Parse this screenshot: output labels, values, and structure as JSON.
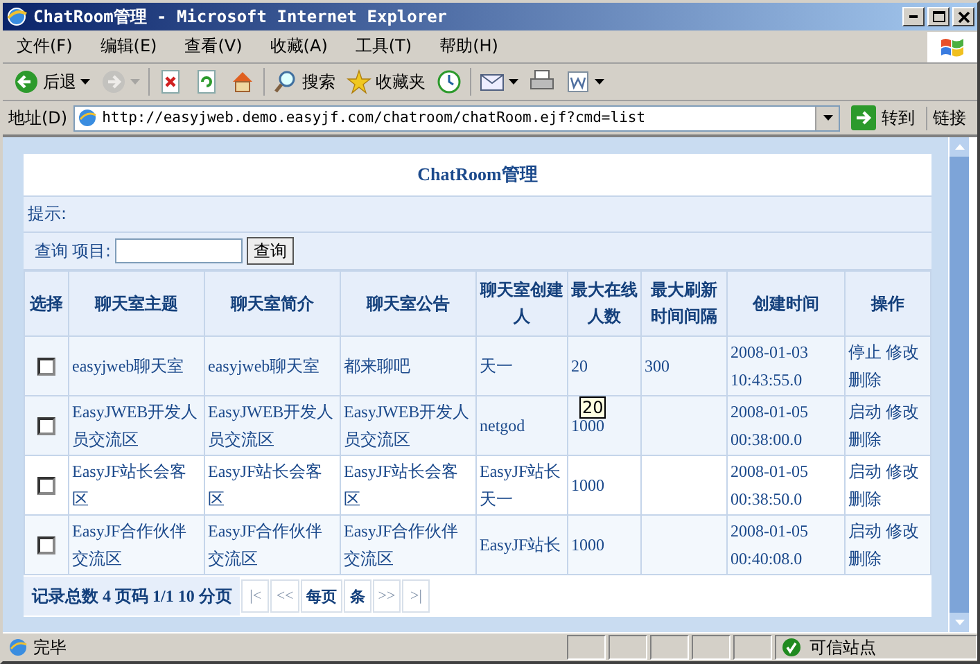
{
  "window": {
    "title": "ChatRoom管理 - Microsoft Internet Explorer"
  },
  "menu": [
    "文件(F)",
    "编辑(E)",
    "查看(V)",
    "收藏(A)",
    "工具(T)",
    "帮助(H)"
  ],
  "toolbar": [
    {
      "label": "后退",
      "caret": true,
      "disabled": false
    },
    {
      "caret": true,
      "disabled": true
    },
    {
      "caret": false,
      "disabled": false
    },
    {
      "caret": false,
      "disabled": false
    },
    {
      "caret": false,
      "disabled": false
    },
    {
      "label": "搜索",
      "caret": false,
      "disabled": false
    },
    {
      "label": "收藏夹",
      "caret": false,
      "disabled": false
    },
    {
      "caret": false,
      "disabled": false
    },
    {
      "caret": true,
      "disabled": false
    },
    {
      "caret": false,
      "disabled": false
    },
    {
      "caret": true,
      "disabled": false
    }
  ],
  "address": {
    "label": "地址(D)",
    "url": "http://easyjweb.demo.easyjf.com/chatroom/chatRoom.ejf?cmd=list",
    "go": "转到",
    "links": "链接"
  },
  "page": {
    "title": "ChatRoom管理",
    "hint": "提示:",
    "query_label": "查询",
    "field_label": "项目:",
    "query_button": "查询",
    "table": {
      "columns": [
        "选择",
        "聊天室主题",
        "聊天室简介",
        "聊天室公告",
        "聊天室创建人",
        "最大在线人数",
        "最大刷新时间间隔",
        "创建时间",
        "操作"
      ],
      "rows": [
        {
          "checked": false,
          "topic": "easyjweb聊天室",
          "intro": "easyjweb聊天室",
          "notice": "都来聊吧",
          "creator": "天一",
          "max_online": "20",
          "refresh": "300",
          "created": "2008-01-03 10:43:55.0",
          "actions": [
            "停止",
            "修改",
            "删除"
          ]
        },
        {
          "checked": false,
          "topic": "EasyJWEB开发人员交流区",
          "intro": "EasyJWEB开发人员交流区",
          "notice": "EasyJWEB开发人员交流区",
          "creator": "netgod",
          "max_online": "1000",
          "refresh": "",
          "created": "2008-01-05 00:38:00.0",
          "actions": [
            "启动",
            "修改",
            "删除"
          ]
        },
        {
          "checked": false,
          "topic": "EasyJF站长会客区",
          "intro": "EasyJF站长会客区",
          "notice": "EasyJF站长会客区",
          "creator": "EasyJF站长天一",
          "max_online": "1000",
          "refresh": "",
          "created": "2008-01-05 00:38:50.0",
          "actions": [
            "启动",
            "修改",
            "删除"
          ]
        },
        {
          "checked": false,
          "topic": "EasyJF合作伙伴交流区",
          "intro": "EasyJF合作伙伴交流区",
          "notice": "EasyJF合作伙伴交流区",
          "creator": "EasyJF站长",
          "max_online": "1000",
          "refresh": "",
          "created": "2008-01-05 00:40:08.0",
          "actions": [
            "启动",
            "修改",
            "删除"
          ]
        }
      ]
    },
    "footer": "记录总数 4 页码 1/1 10 分页",
    "pager": [
      {
        "label": "|<",
        "disabled": true
      },
      {
        "label": "<<",
        "disabled": true
      },
      {
        "label": "每页",
        "disabled": false
      },
      {
        "label": "条",
        "disabled": false
      },
      {
        "label": ">>",
        "disabled": true
      },
      {
        "label": ">|",
        "disabled": true
      }
    ],
    "tooltip": "20"
  },
  "status_bar": {
    "text": "完毕",
    "zone": "可信站点"
  }
}
